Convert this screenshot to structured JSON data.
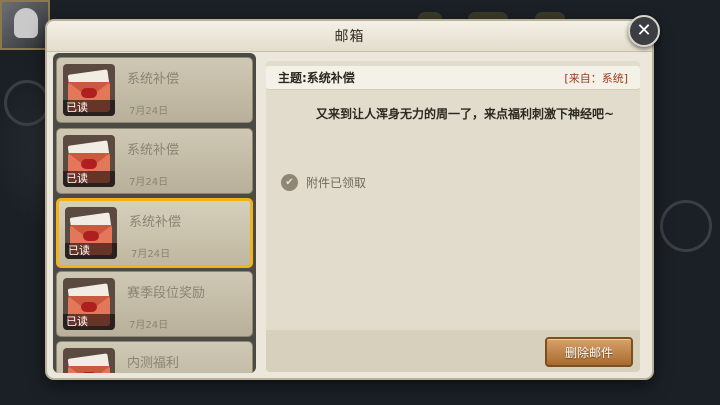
{
  "modal": {
    "title": "邮箱"
  },
  "mail_list": [
    {
      "subject": "系统补偿",
      "date": "7月24日",
      "status": "已读",
      "selected": false
    },
    {
      "subject": "系统补偿",
      "date": "7月24日",
      "status": "已读",
      "selected": false
    },
    {
      "subject": "系统补偿",
      "date": "7月24日",
      "status": "已读",
      "selected": true
    },
    {
      "subject": "赛季段位奖励",
      "date": "7月24日",
      "status": "已读",
      "selected": false
    },
    {
      "subject": "内测福利",
      "date": "",
      "status": "",
      "selected": false
    }
  ],
  "detail": {
    "subject_label": "主题:系统补偿",
    "sender_label": "[来自：系统]",
    "body": "又来到让人浑身无力的周一了，来点福利刺激下神经吧~",
    "attachment_status": "附件已领取"
  },
  "actions": {
    "delete_label": "删除邮件",
    "close_icon": "close-icon"
  },
  "colors": {
    "accent_selected": "#f1b21a",
    "sender_text": "#9c3b1c",
    "delete_button": "#c58a4c"
  }
}
